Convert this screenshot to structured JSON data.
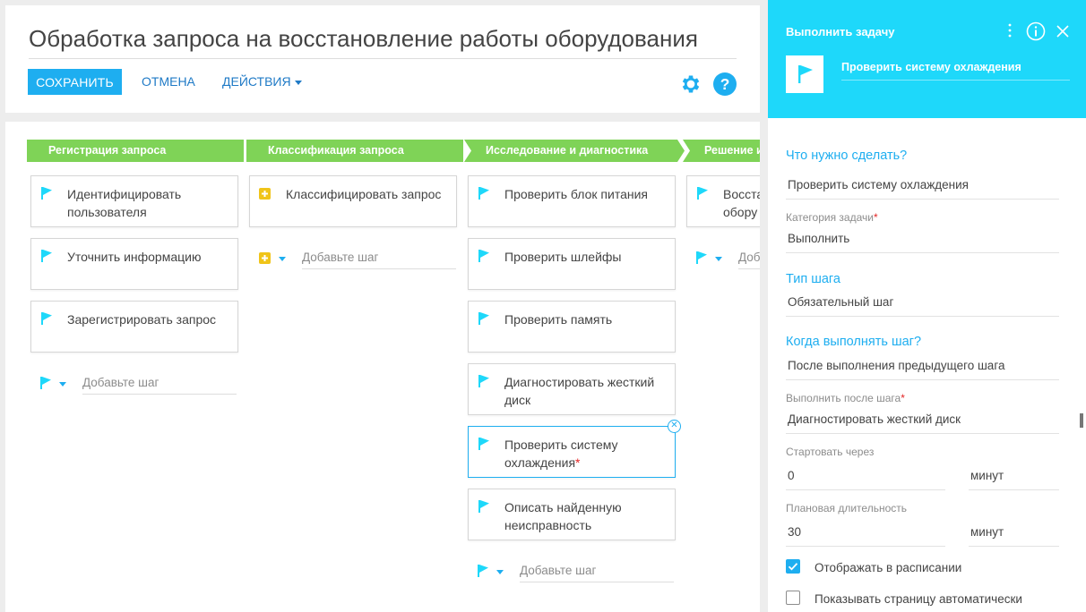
{
  "header": {
    "title": "Обработка запроса на восстановление работы оборудования",
    "save_label": "СОХРАНИТЬ",
    "cancel_label": "ОТМЕНА",
    "actions_label": "ДЕЙСТВИЯ"
  },
  "stages": [
    "Регистрация запроса",
    "Классификация запроса",
    "Исследование и диагностика",
    "Решение и"
  ],
  "columns": {
    "col1": {
      "tasks": [
        "Идентифицировать пользователя",
        "Уточнить информацию",
        "Зарегистрировать запрос"
      ],
      "add_label": "Добавьте шаг"
    },
    "col2": {
      "tasks": [
        "Классифицировать запрос"
      ],
      "add_label": "Добавьте шаг"
    },
    "col3": {
      "tasks": [
        "Проверить блок питания",
        "Проверить шлейфы",
        "Проверить память",
        "Диагностировать жесткий диск",
        "Проверить систему охлаждения",
        "Описать найденную неисправность"
      ],
      "add_label": "Добавьте шаг"
    },
    "col4": {
      "tasks": [
        "Восста обору"
      ],
      "add_label": "Доб"
    }
  },
  "required_mark": "*",
  "close_glyph": "✕",
  "panel": {
    "title": "Выполнить задачу",
    "task_name": "Проверить систему охлаждения",
    "what_heading": "Что нужно сделать?",
    "what_value": "Проверить систему охлаждения",
    "category_label": "Категория задачи",
    "category_value": "Выполнить",
    "step_type_heading": "Тип шага",
    "step_type_value": "Обязательный шаг",
    "when_heading": "Когда выполнять шаг?",
    "when_value": "После выполнения предыдущего шага",
    "after_label": "Выполнить после шага",
    "after_value": "Диагностировать жесткий диск",
    "start_label": "Стартовать через",
    "start_value": "0",
    "start_unit": "минут",
    "duration_label": "Плановая длительность",
    "duration_value": "30",
    "duration_unit": "минут",
    "show_schedule_label": "Отображать в расписании",
    "show_schedule_checked": true,
    "show_page_label": "Показывать страницу автоматически",
    "show_page_checked": false
  },
  "colors": {
    "accent": "#1eaef0",
    "panel_header": "#1ed8fa",
    "stage_green": "#7fd357",
    "required": "#e32626"
  }
}
